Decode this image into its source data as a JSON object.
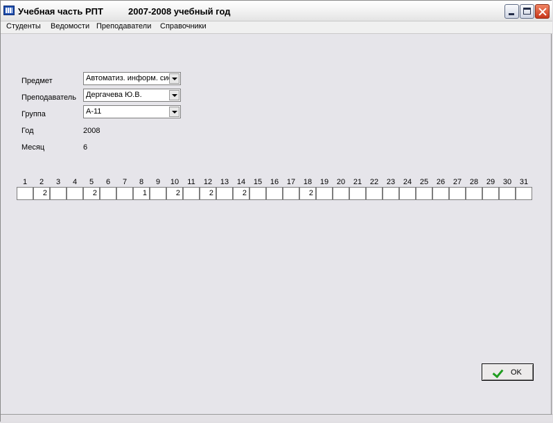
{
  "window": {
    "title": "Учебная часть РПТ          2007-2008 учебный год",
    "app_icon": "journal-app-icon"
  },
  "menu": [
    "Студенты",
    "Ведомости",
    "Преподаватели",
    "Справочники"
  ],
  "form": {
    "subject_label": "Предмет",
    "subject_value": "Автоматиз. информ. сис",
    "teacher_label": "Преподаватель",
    "teacher_value": "Дергачева Ю.В.",
    "group_label": "Группа",
    "group_value": "А-11",
    "year_label": "Год",
    "year_value": "2008",
    "month_label": "Месяц",
    "month_value": "6"
  },
  "days": [
    "1",
    "2",
    "3",
    "4",
    "5",
    "6",
    "7",
    "8",
    "9",
    "10",
    "11",
    "12",
    "13",
    "14",
    "15",
    "16",
    "17",
    "18",
    "19",
    "20",
    "21",
    "22",
    "23",
    "24",
    "25",
    "26",
    "27",
    "28",
    "29",
    "30",
    "31"
  ],
  "marks": [
    "",
    "2",
    "",
    "",
    "2",
    "",
    "",
    "1",
    "",
    "2",
    "",
    "2",
    "",
    "2",
    "",
    "",
    "",
    "2",
    "",
    "",
    "",
    "",
    "",
    "",
    "",
    "",
    "",
    "",
    "",
    "",
    ""
  ],
  "ok_button": {
    "label": "OK",
    "icon": "checkmark-icon",
    "icon_color": "#1f9d1f"
  }
}
